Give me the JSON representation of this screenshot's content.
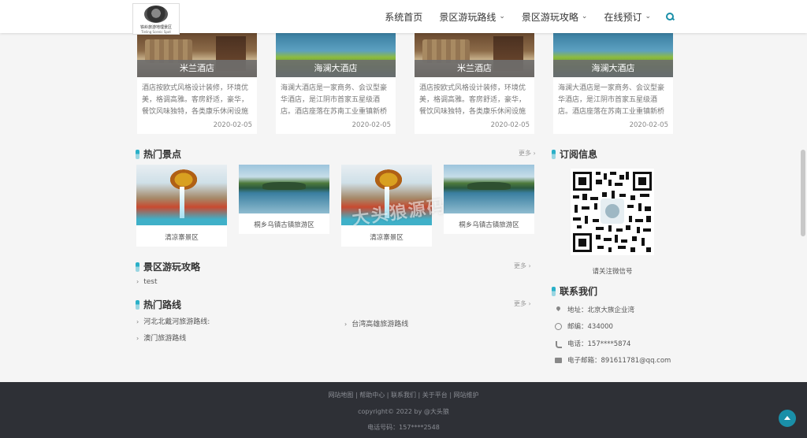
{
  "header": {
    "logo_text": "铁岭旅游地理景区",
    "logo_sub": "Tieling Scenic Spot",
    "nav": [
      {
        "label": "系统首页",
        "dropdown": false
      },
      {
        "label": "景区游玩路线",
        "dropdown": true
      },
      {
        "label": "景区游玩攻略",
        "dropdown": true
      },
      {
        "label": "在线预订",
        "dropdown": true
      }
    ],
    "search_icon": "search-icon"
  },
  "hotels": [
    {
      "name": "米兰酒店",
      "image": "hotel-room",
      "desc": "酒店按欧式风格设计装修，环境优美，格调高雅。客房舒适，豪华，餐饮风味独特，各类康乐休闲设施一应",
      "date": "2020-02-05"
    },
    {
      "name": "海澜大酒店",
      "image": "lake",
      "desc": "海澜大酒店是一家商务、会议型豪华酒店，是江阴市首家五星级酒店。酒店座落在苏南工业重镇新桥镇海澜工",
      "date": "2020-02-05"
    },
    {
      "name": "米兰酒店",
      "image": "hotel-room",
      "desc": "酒店按欧式风格设计装修，环境优美，格调高雅。客房舒适，豪华，餐饮风味独特，各类康乐休闲设施一应",
      "date": "2020-02-05"
    },
    {
      "name": "海澜大酒店",
      "image": "lake",
      "desc": "海澜大酒店是一家商务、会议型豪华酒店，是江阴市首家五星级酒店。酒店座落在苏南工业重镇新桥镇海澜工",
      "date": "2020-02-05"
    }
  ],
  "hot_spots": {
    "title": "热门景点",
    "more": "更多 ›",
    "items": [
      {
        "name": "清凉寨景区",
        "image": "dragon"
      },
      {
        "name": "桐乡乌镇古镇旅游区",
        "image": "lake"
      },
      {
        "name": "清凉寨景区",
        "image": "dragon"
      },
      {
        "name": "桐乡乌镇古镇旅游区",
        "image": "lake"
      }
    ]
  },
  "guides": {
    "title": "景区游玩攻略",
    "more": "更多 ›",
    "items": [
      "test"
    ]
  },
  "routes": {
    "title": "热门路线",
    "more": "更多 ›",
    "items": [
      "河北北戴河旅游路线:",
      "澳门旅游路线",
      "台湾高雄旅游路线"
    ]
  },
  "subscribe": {
    "title": "订阅信息",
    "caption": "请关注微信号"
  },
  "contact": {
    "title": "联系我们",
    "address": "地址：北京大族企业湾",
    "postcode": "邮编：434000",
    "phone": "电话：157****5874",
    "email": "电子邮箱：891611781@qq.com"
  },
  "watermark": "大头狼源码",
  "footer": {
    "links": "网站地图 | 帮助中心 | 联系我们 | 关于平台 | 网站维护",
    "copyright": "copyright© 2022 by @大头狼",
    "phone": "电话号码：157****2548"
  },
  "colors": {
    "accent": "#1a8fa8",
    "footer_bg": "#2e3036"
  }
}
